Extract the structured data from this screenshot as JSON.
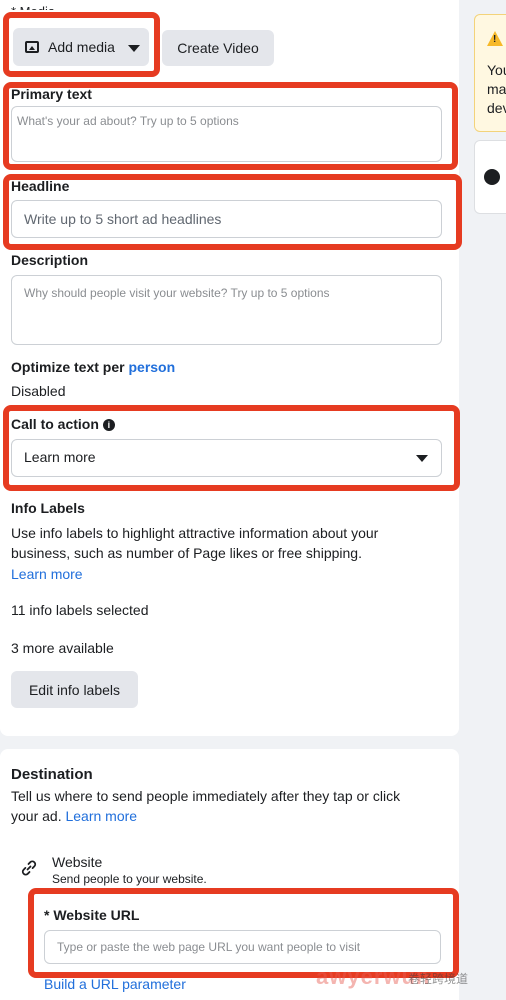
{
  "media": {
    "section_label": "* Media",
    "add_media_label": "Add media",
    "create_video_label": "Create Video"
  },
  "primary_text": {
    "label": "Primary text",
    "placeholder": "What's your ad about? Try up to 5 options"
  },
  "headline": {
    "label": "Headline",
    "placeholder": "Write up to 5 short ad headlines"
  },
  "description": {
    "label": "Description",
    "placeholder": "Why should people visit your website? Try up to 5 options"
  },
  "optimize": {
    "label": "Optimize text per",
    "link": "person",
    "status": "Disabled"
  },
  "cta": {
    "label": "Call to action",
    "value": "Learn more"
  },
  "info_labels": {
    "title": "Info Labels",
    "description_line1": "Use info labels to highlight attractive information about your",
    "description_line2": "business, such as number of Page likes or free shipping.",
    "learn_more": "Learn more",
    "selected": "11 info labels selected",
    "available": "3 more available",
    "edit_button": "Edit info labels"
  },
  "destination": {
    "title": "Destination",
    "line1": "Tell us where to send people immediately after they tap or click",
    "line2": "your ad.",
    "learn_more": "Learn more",
    "website_title": "Website",
    "website_sub": "Send people to your website.",
    "url_label": "* Website URL",
    "url_placeholder": "Type or paste the web page URL you want people to visit",
    "url_param_link": "Build a URL parameter"
  },
  "side_panel": {
    "warning_text": "You\nma\ndev"
  },
  "watermark": {
    "brand": "awyerwun",
    "cn": "卷轻跨境道"
  },
  "colors": {
    "highlight_border": "#e63b21",
    "link": "#216fdb",
    "warning": "#f7b928"
  }
}
